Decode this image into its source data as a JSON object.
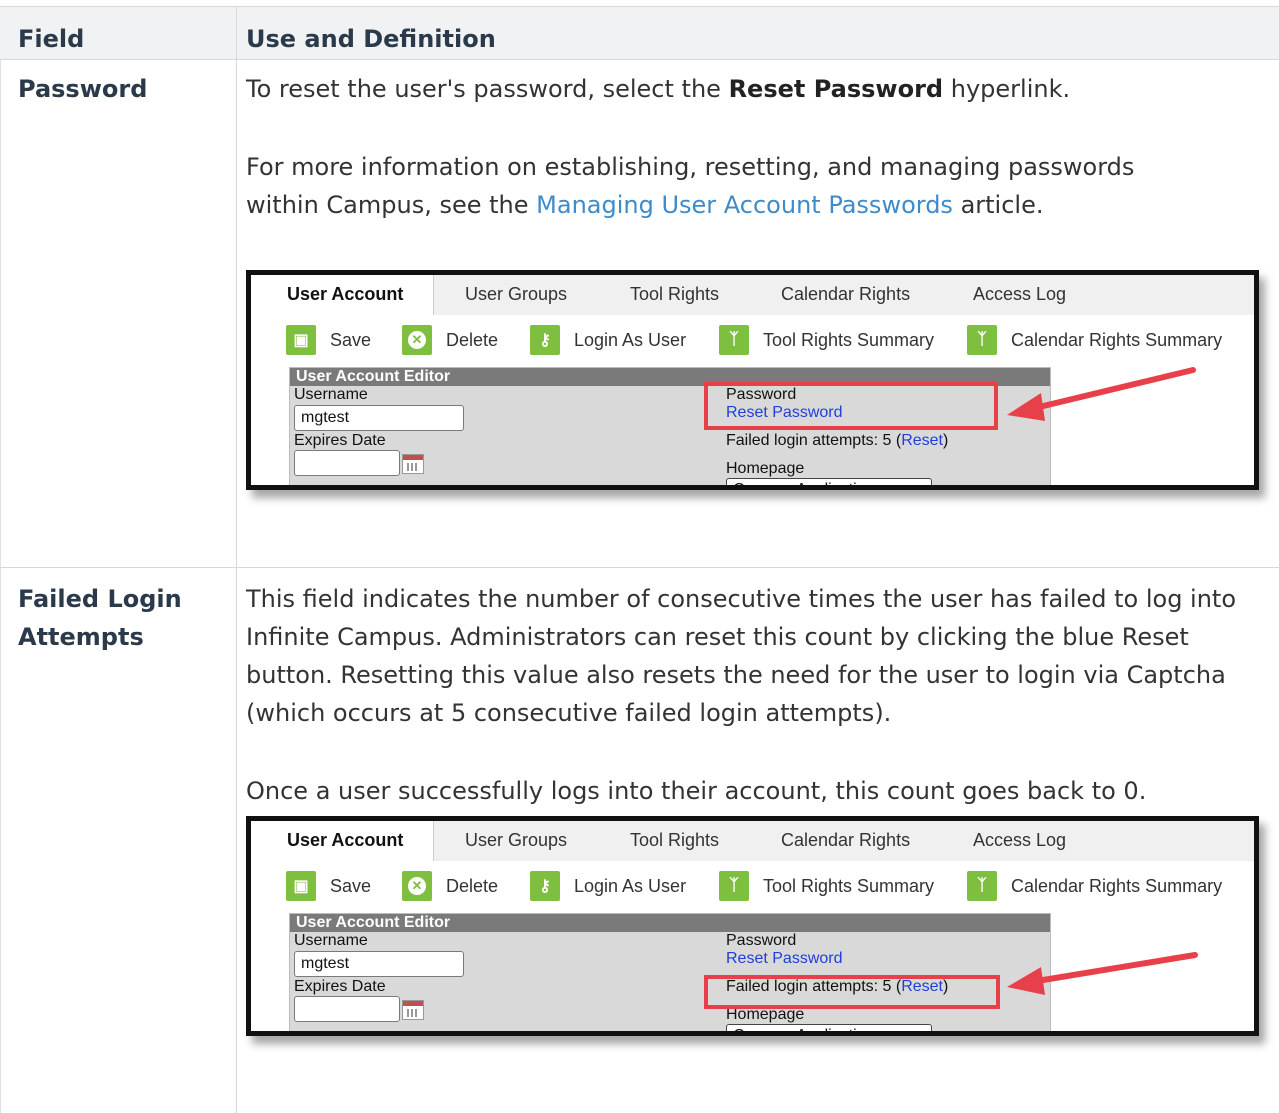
{
  "table": {
    "header_field": "Field",
    "header_definition": "Use and Definition"
  },
  "rows": [
    {
      "field": "Password",
      "p1_pre": "To reset the user's password, select the ",
      "p1_bold": "Reset Password",
      "p1_post": " hyperlink.",
      "p2_pre": "For more information on establishing, resetting, and managing passwords within Campus, see the ",
      "p2_link": "Managing User Account Passwords",
      "p2_post": " article."
    },
    {
      "field": "Failed Login Attempts",
      "p1": "This field indicates the number of consecutive times the user has failed to log into Infinite Campus. Administrators can reset this count by clicking the blue Reset button. Resetting this value also resets the need for the user to login via Captcha (which occurs at 5 consecutive failed login attempts).",
      "p2": "Once a user successfully logs into their account, this count goes back to 0."
    }
  ],
  "screenshot": {
    "tabs": [
      "User Account",
      "User Groups",
      "Tool Rights",
      "Calendar Rights",
      "Access Log"
    ],
    "toolbar": [
      "Save",
      "Delete",
      "Login As User",
      "Tool Rights Summary",
      "Calendar Rights Summary"
    ],
    "editor_title": "User Account Editor",
    "username_label": "Username",
    "username_value": "mgtest",
    "expires_label": "Expires Date",
    "password_label": "Password",
    "reset_password": "Reset Password",
    "failed_prefix": "Failed login attempts: 5 (",
    "failed_reset": "Reset",
    "failed_suffix": ")",
    "homepage_label": "Homepage",
    "homepage_value": "Campus Application"
  },
  "colors": {
    "link": "#3f8ac8",
    "icon_green": "#7fbf3f",
    "highlight_red": "#e8404a"
  }
}
